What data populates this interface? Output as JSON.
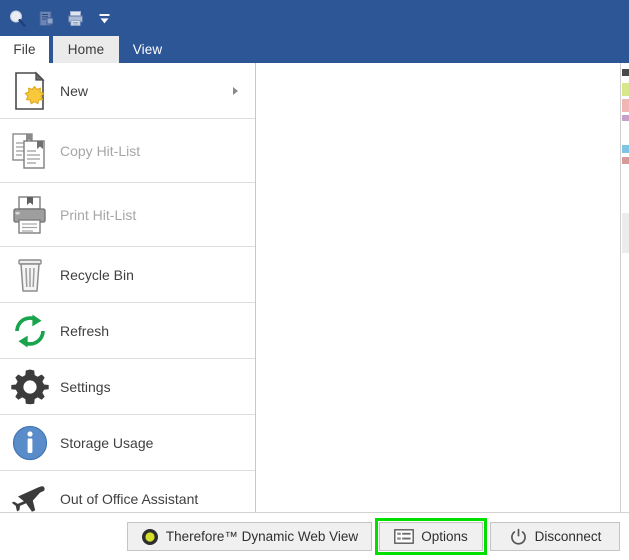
{
  "window": {
    "accent_color": "#2d5697",
    "highlight_color": "#00e000"
  },
  "quick_access_toolbar": {
    "items": [
      {
        "name": "search-icon",
        "label": "Search"
      },
      {
        "name": "document-properties-icon",
        "label": "Document Properties"
      },
      {
        "name": "print-save-icon",
        "label": "Print"
      },
      {
        "name": "customize-dropdown-icon",
        "label": "Customize Quick Access Toolbar"
      }
    ]
  },
  "tabs": [
    {
      "id": "file",
      "label": "File"
    },
    {
      "id": "home",
      "label": "Home"
    },
    {
      "id": "view",
      "label": "View"
    }
  ],
  "menu": {
    "items": [
      {
        "id": "new",
        "label": "New",
        "icon": "new-document-icon",
        "disabled": false,
        "has_submenu": true
      },
      {
        "id": "copy-hit-list",
        "label": "Copy Hit-List",
        "icon": "copy-documents-icon",
        "disabled": true,
        "has_submenu": false
      },
      {
        "id": "print-hit-list",
        "label": "Print Hit-List",
        "icon": "printer-icon",
        "disabled": true,
        "has_submenu": false
      },
      {
        "id": "recycle-bin",
        "label": "Recycle Bin",
        "icon": "trash-can-icon",
        "disabled": false,
        "has_submenu": false
      },
      {
        "id": "refresh",
        "label": "Refresh",
        "icon": "refresh-arrows-icon",
        "disabled": false,
        "has_submenu": false
      },
      {
        "id": "settings",
        "label": "Settings",
        "icon": "gear-icon",
        "disabled": false,
        "has_submenu": false
      },
      {
        "id": "storage-usage",
        "label": "Storage Usage",
        "icon": "info-circle-icon",
        "disabled": false,
        "has_submenu": false
      },
      {
        "id": "out-of-office",
        "label": "Out of Office Assistant",
        "icon": "airplane-icon",
        "disabled": false,
        "has_submenu": false
      }
    ]
  },
  "bottom_bar": {
    "buttons": [
      {
        "id": "dynamic-web-view",
        "label": "Therefore™ Dynamic Web View",
        "icon": "therefore-logo-icon",
        "highlighted": false
      },
      {
        "id": "options",
        "label": "Options",
        "icon": "options-list-icon",
        "highlighted": true
      },
      {
        "id": "disconnect",
        "label": "Disconnect",
        "icon": "power-icon",
        "highlighted": false
      }
    ]
  }
}
